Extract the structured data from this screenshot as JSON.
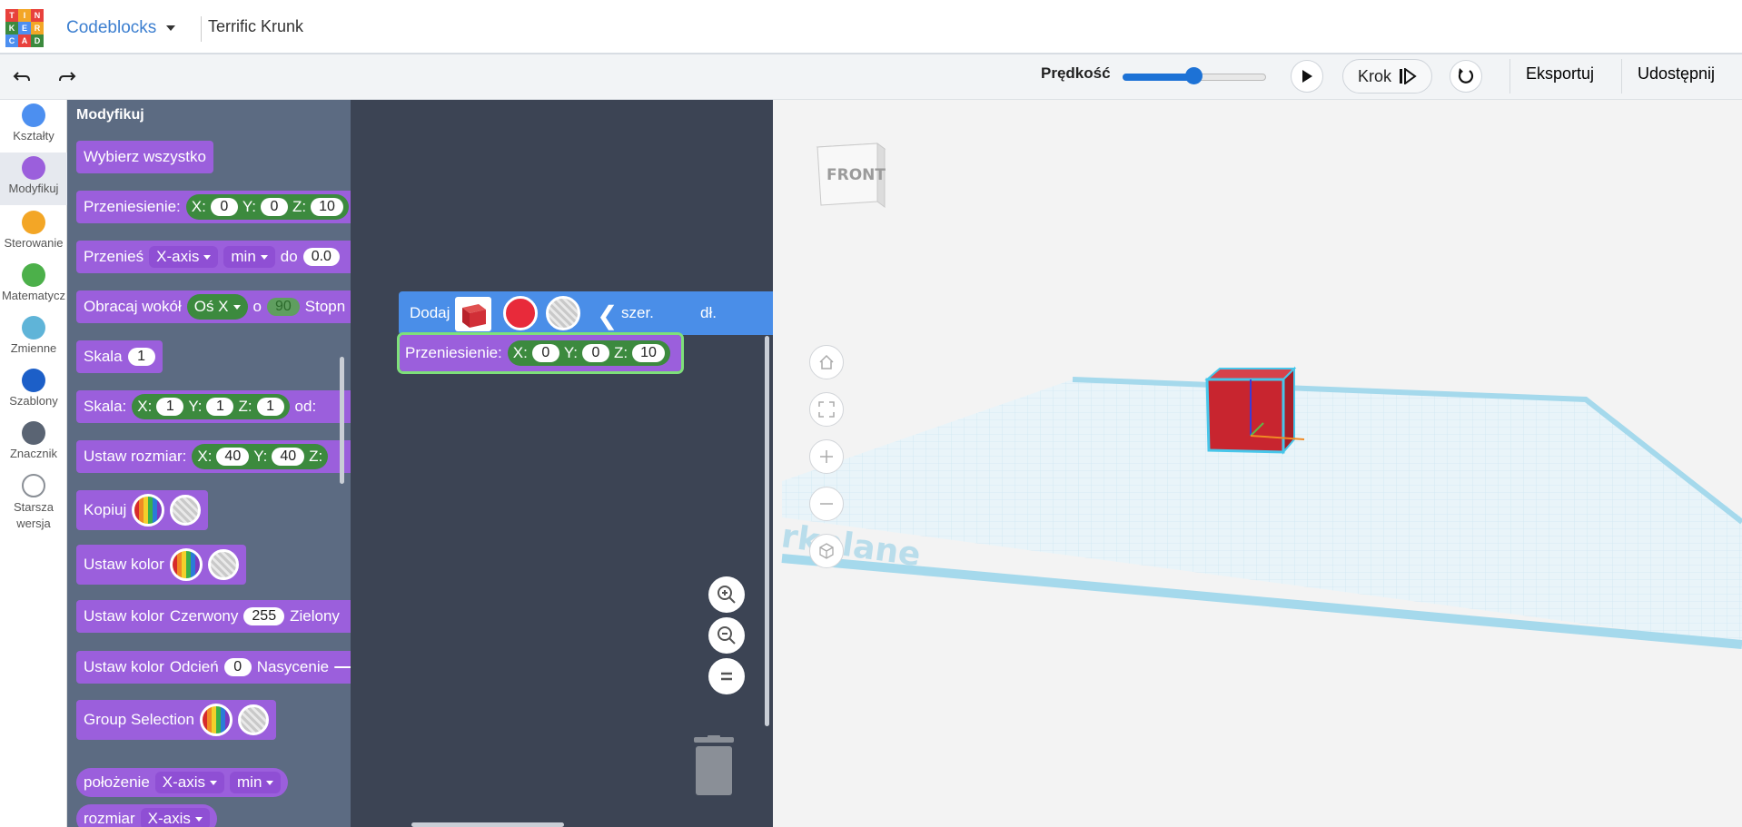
{
  "header": {
    "logo_letters": [
      "T",
      "I",
      "N",
      "K",
      "E",
      "R",
      "C",
      "A",
      "D"
    ],
    "app_name": "Codeblocks",
    "doc_title": "Terrific Krunk"
  },
  "toolbar": {
    "undo_icon": "undo-icon",
    "redo_icon": "redo-icon",
    "speed_label": "Prędkość",
    "speed_level_percent": 50,
    "step_label": "Krok",
    "export_label": "Eksportuj",
    "share_label": "Udostępnij"
  },
  "categories": [
    {
      "label": "Kształty",
      "color": "#4c8ff0"
    },
    {
      "label": "Modyfikuj",
      "color": "#9b5fdc",
      "selected": true
    },
    {
      "label": "Sterowanie",
      "color": "#f3a626"
    },
    {
      "label": "Matematycz",
      "color": "#4cb04a"
    },
    {
      "label": "Zmienne",
      "color": "#5fb4d8"
    },
    {
      "label": "Szablony",
      "color": "#1c5fc8"
    },
    {
      "label": "Znacznik",
      "color": "#5a6473"
    },
    {
      "label": "Starsza wersja",
      "color": "#ffffff"
    }
  ],
  "flyout": {
    "title": "Modyfikuj",
    "select_all": "Wybierz wszystko",
    "move": {
      "label": "Przeniesienie:",
      "x_label": "X:",
      "x": "0",
      "y_label": "Y:",
      "y": "0",
      "z_label": "Z:",
      "z": "10"
    },
    "move_along": {
      "label": "Przenieś",
      "axis": "X-axis",
      "edge": "min",
      "to": "do",
      "value": "0.0"
    },
    "rotate": {
      "label": "Obracaj wokół",
      "axis": "Oś X",
      "o": "o",
      "value": "90",
      "unit": "Stopn"
    },
    "scale": {
      "label": "Skala",
      "value": "1"
    },
    "scale_xyz": {
      "label": "Skala:",
      "x_label": "X:",
      "x": "1",
      "y_label": "Y:",
      "y": "1",
      "z_label": "Z:",
      "z": "1",
      "from": "od:"
    },
    "resize": {
      "label": "Ustaw rozmiar:",
      "x_label": "X:",
      "x": "40",
      "y_label": "Y:",
      "y": "40",
      "z_label": "Z:"
    },
    "copy": {
      "label": "Kopiuj"
    },
    "set_color": {
      "label": "Ustaw kolor"
    },
    "set_color_rgb": {
      "label": "Ustaw kolor",
      "red": "Czerwony",
      "red_value": "255",
      "green": "Zielony"
    },
    "set_color_hsv": {
      "label": "Ustaw kolor",
      "hue": "Odcień",
      "hue_value": "0",
      "saturation": "Nasycenie"
    },
    "group": {
      "label": "Group Selection"
    },
    "position": {
      "label": "położenie",
      "axis": "X-axis",
      "edge": "min"
    },
    "size": {
      "label": "rozmiar",
      "axis": "X-axis"
    }
  },
  "workspace": {
    "add_block": {
      "label": "Dodaj",
      "color": "#e82a3a",
      "width_label": "szer.",
      "depth_label": "dł."
    },
    "move_block": {
      "label": "Przeniesienie:",
      "x_label": "X:",
      "x": "0",
      "y_label": "Y:",
      "y": "0",
      "z_label": "Z:",
      "z": "10"
    },
    "zoom_in_icon": "zoom-in-icon",
    "zoom_out_icon": "zoom-out-icon",
    "zoom_reset_icon": "zoom-reset-icon",
    "trash_icon": "trash-icon"
  },
  "viewport": {
    "viewcube_face": "FRONT",
    "workplane_text": "rkplane",
    "cube_color": "#c8252f",
    "nav": [
      "home-icon",
      "fit-icon",
      "zoom-in-icon",
      "zoom-out-icon",
      "perspective-icon"
    ]
  }
}
